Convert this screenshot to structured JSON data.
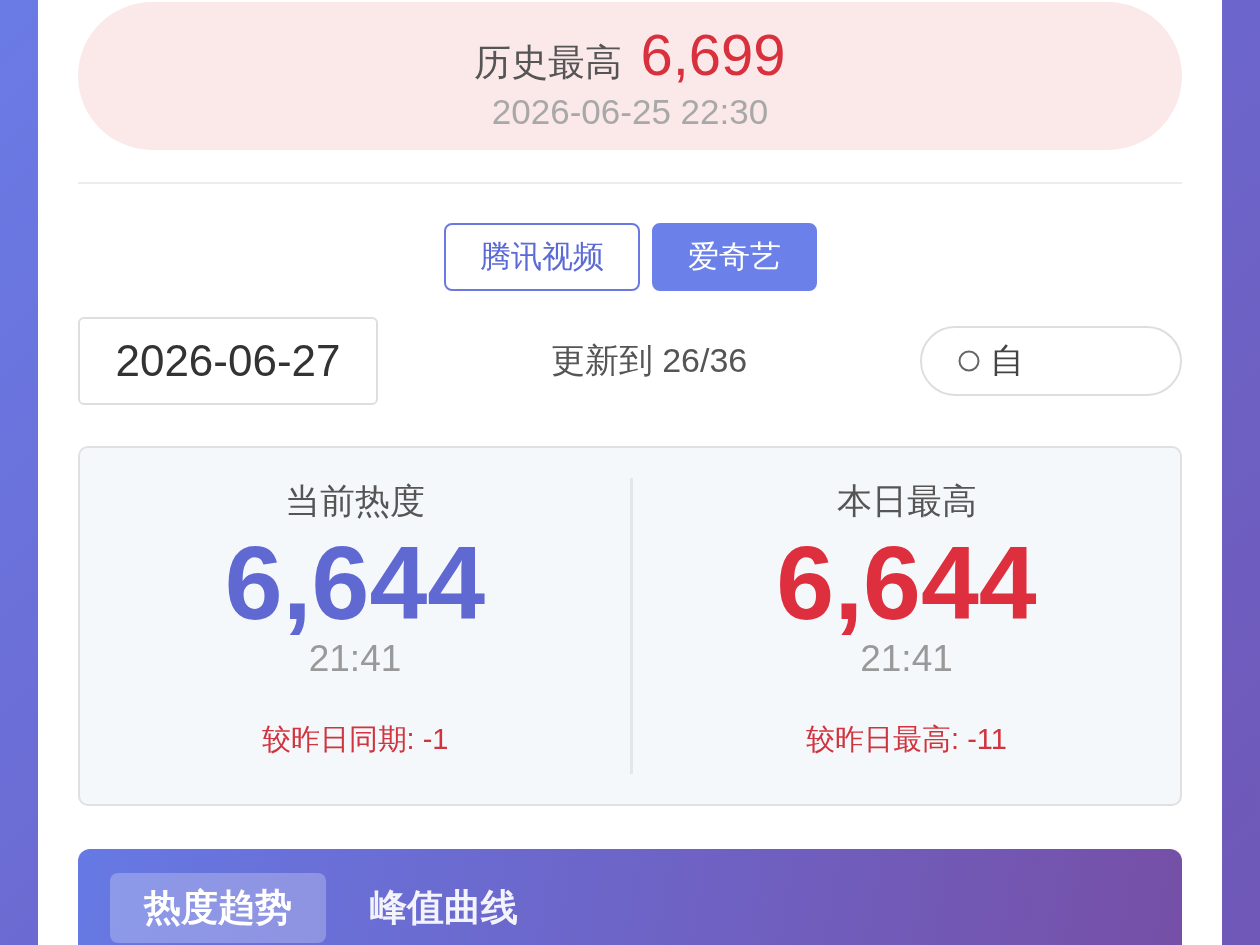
{
  "record": {
    "label": "历史最高",
    "value": "6,699",
    "time": "2026-06-25 22:30"
  },
  "platform_tabs": [
    {
      "label": "腾讯视频",
      "selected": false
    },
    {
      "label": "爱奇艺",
      "selected": true
    }
  ],
  "date_field": {
    "value": "2026-06-27"
  },
  "update_status": "更新到 26/36",
  "auto_toggle": {
    "label": "自",
    "checked": false
  },
  "stats": [
    {
      "label": "当前热度",
      "value": "6,644",
      "color": "#5f69d1",
      "time": "21:41",
      "comparison": "较昨日同期: -1"
    },
    {
      "label": "本日最高",
      "value": "6,644",
      "color": "#de2f3e",
      "time": "21:41",
      "comparison": "较昨日最高: -11"
    }
  ],
  "chart_tabs": [
    {
      "label": "热度趋势",
      "selected": true
    },
    {
      "label": "峰值曲线",
      "selected": false
    }
  ]
}
